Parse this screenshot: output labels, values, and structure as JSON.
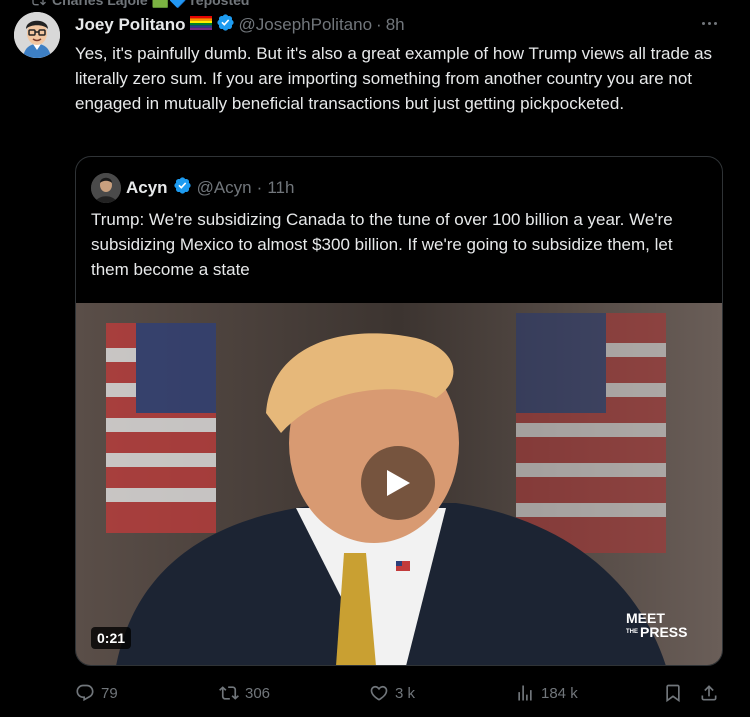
{
  "repost_banner": {
    "text": "Charles Lajoie 🟩🔷 reposted"
  },
  "tweet": {
    "display_name": "Joey Politano",
    "handle": "@JosephPolitano",
    "separator": "·",
    "time": "8h",
    "text": "Yes, it's painfully dumb. But it's also a great example of how Trump views all trade as literally zero sum. If you are importing something from another country you are not engaged in mutually beneficial transactions but just getting pickpocketed."
  },
  "quote": {
    "display_name": "Acyn",
    "handle": "@Acyn",
    "separator": "·",
    "time": "11h",
    "text": "Trump: We're subsidizing Canada to the tune of over 100 billion a year. We're subsidizing Mexico to almost $300 billion. If we're going to subsidize them, let them become a state",
    "video": {
      "duration": "0:21",
      "logo_line1": "MEET",
      "logo_line2": "PRESS",
      "logo_small": "THE"
    }
  },
  "actions": {
    "replies": "79",
    "reposts": "306",
    "likes": "3 k",
    "views": "184 k"
  },
  "colors": {
    "background": "#000000",
    "text": "#e7e9ea",
    "muted": "#71767b",
    "verified": "#1d9bf0",
    "border": "#2f3336"
  },
  "icons": {
    "verified": "verified-badge-icon",
    "pride_flag": "rainbow-flag-icon",
    "more": "more-dots-icon",
    "play": "play-icon",
    "reply": "reply-icon",
    "repost": "repost-icon",
    "like": "heart-icon",
    "views": "views-chart-icon",
    "bookmark": "bookmark-icon",
    "share": "share-icon"
  }
}
